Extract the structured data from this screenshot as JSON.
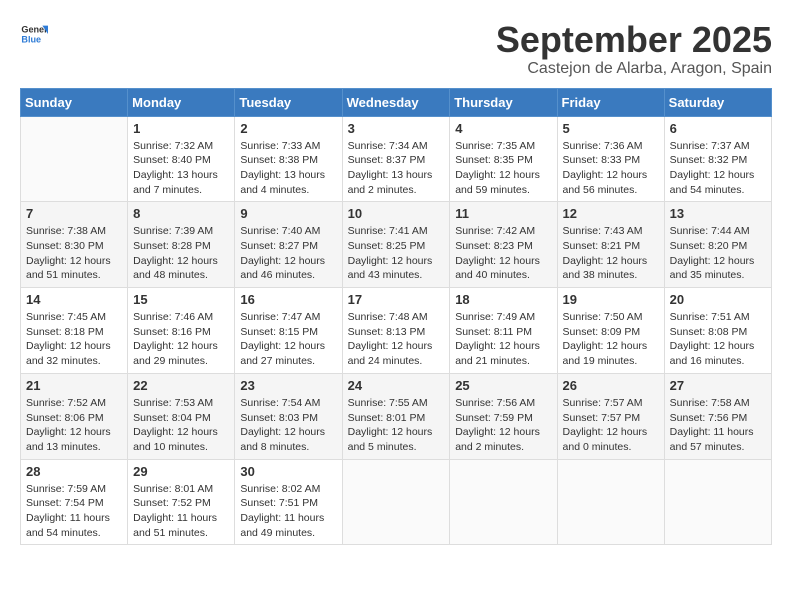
{
  "logo": {
    "general": "General",
    "blue": "Blue"
  },
  "title": "September 2025",
  "location": "Castejon de Alarba, Aragon, Spain",
  "weekdays": [
    "Sunday",
    "Monday",
    "Tuesday",
    "Wednesday",
    "Thursday",
    "Friday",
    "Saturday"
  ],
  "weeks": [
    [
      {
        "day": "",
        "info": ""
      },
      {
        "day": "1",
        "info": "Sunrise: 7:32 AM\nSunset: 8:40 PM\nDaylight: 13 hours\nand 7 minutes."
      },
      {
        "day": "2",
        "info": "Sunrise: 7:33 AM\nSunset: 8:38 PM\nDaylight: 13 hours\nand 4 minutes."
      },
      {
        "day": "3",
        "info": "Sunrise: 7:34 AM\nSunset: 8:37 PM\nDaylight: 13 hours\nand 2 minutes."
      },
      {
        "day": "4",
        "info": "Sunrise: 7:35 AM\nSunset: 8:35 PM\nDaylight: 12 hours\nand 59 minutes."
      },
      {
        "day": "5",
        "info": "Sunrise: 7:36 AM\nSunset: 8:33 PM\nDaylight: 12 hours\nand 56 minutes."
      },
      {
        "day": "6",
        "info": "Sunrise: 7:37 AM\nSunset: 8:32 PM\nDaylight: 12 hours\nand 54 minutes."
      }
    ],
    [
      {
        "day": "7",
        "info": "Sunrise: 7:38 AM\nSunset: 8:30 PM\nDaylight: 12 hours\nand 51 minutes."
      },
      {
        "day": "8",
        "info": "Sunrise: 7:39 AM\nSunset: 8:28 PM\nDaylight: 12 hours\nand 48 minutes."
      },
      {
        "day": "9",
        "info": "Sunrise: 7:40 AM\nSunset: 8:27 PM\nDaylight: 12 hours\nand 46 minutes."
      },
      {
        "day": "10",
        "info": "Sunrise: 7:41 AM\nSunset: 8:25 PM\nDaylight: 12 hours\nand 43 minutes."
      },
      {
        "day": "11",
        "info": "Sunrise: 7:42 AM\nSunset: 8:23 PM\nDaylight: 12 hours\nand 40 minutes."
      },
      {
        "day": "12",
        "info": "Sunrise: 7:43 AM\nSunset: 8:21 PM\nDaylight: 12 hours\nand 38 minutes."
      },
      {
        "day": "13",
        "info": "Sunrise: 7:44 AM\nSunset: 8:20 PM\nDaylight: 12 hours\nand 35 minutes."
      }
    ],
    [
      {
        "day": "14",
        "info": "Sunrise: 7:45 AM\nSunset: 8:18 PM\nDaylight: 12 hours\nand 32 minutes."
      },
      {
        "day": "15",
        "info": "Sunrise: 7:46 AM\nSunset: 8:16 PM\nDaylight: 12 hours\nand 29 minutes."
      },
      {
        "day": "16",
        "info": "Sunrise: 7:47 AM\nSunset: 8:15 PM\nDaylight: 12 hours\nand 27 minutes."
      },
      {
        "day": "17",
        "info": "Sunrise: 7:48 AM\nSunset: 8:13 PM\nDaylight: 12 hours\nand 24 minutes."
      },
      {
        "day": "18",
        "info": "Sunrise: 7:49 AM\nSunset: 8:11 PM\nDaylight: 12 hours\nand 21 minutes."
      },
      {
        "day": "19",
        "info": "Sunrise: 7:50 AM\nSunset: 8:09 PM\nDaylight: 12 hours\nand 19 minutes."
      },
      {
        "day": "20",
        "info": "Sunrise: 7:51 AM\nSunset: 8:08 PM\nDaylight: 12 hours\nand 16 minutes."
      }
    ],
    [
      {
        "day": "21",
        "info": "Sunrise: 7:52 AM\nSunset: 8:06 PM\nDaylight: 12 hours\nand 13 minutes."
      },
      {
        "day": "22",
        "info": "Sunrise: 7:53 AM\nSunset: 8:04 PM\nDaylight: 12 hours\nand 10 minutes."
      },
      {
        "day": "23",
        "info": "Sunrise: 7:54 AM\nSunset: 8:03 PM\nDaylight: 12 hours\nand 8 minutes."
      },
      {
        "day": "24",
        "info": "Sunrise: 7:55 AM\nSunset: 8:01 PM\nDaylight: 12 hours\nand 5 minutes."
      },
      {
        "day": "25",
        "info": "Sunrise: 7:56 AM\nSunset: 7:59 PM\nDaylight: 12 hours\nand 2 minutes."
      },
      {
        "day": "26",
        "info": "Sunrise: 7:57 AM\nSunset: 7:57 PM\nDaylight: 12 hours\nand 0 minutes."
      },
      {
        "day": "27",
        "info": "Sunrise: 7:58 AM\nSunset: 7:56 PM\nDaylight: 11 hours\nand 57 minutes."
      }
    ],
    [
      {
        "day": "28",
        "info": "Sunrise: 7:59 AM\nSunset: 7:54 PM\nDaylight: 11 hours\nand 54 minutes."
      },
      {
        "day": "29",
        "info": "Sunrise: 8:01 AM\nSunset: 7:52 PM\nDaylight: 11 hours\nand 51 minutes."
      },
      {
        "day": "30",
        "info": "Sunrise: 8:02 AM\nSunset: 7:51 PM\nDaylight: 11 hours\nand 49 minutes."
      },
      {
        "day": "",
        "info": ""
      },
      {
        "day": "",
        "info": ""
      },
      {
        "day": "",
        "info": ""
      },
      {
        "day": "",
        "info": ""
      }
    ]
  ]
}
